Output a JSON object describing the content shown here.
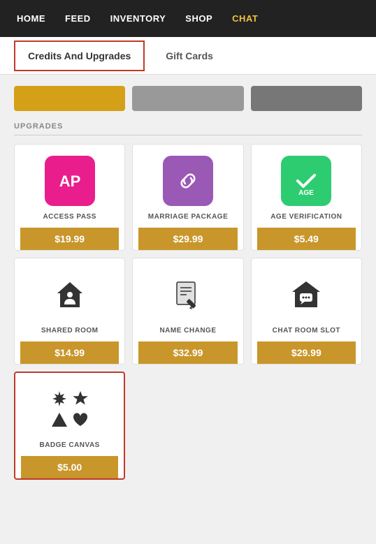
{
  "nav": {
    "items": [
      {
        "label": "HOME",
        "active": false
      },
      {
        "label": "FEED",
        "active": false
      },
      {
        "label": "INVENTORY",
        "active": false
      },
      {
        "label": "SHOP",
        "active": false
      },
      {
        "label": "CHAT",
        "active": true
      }
    ]
  },
  "tabs": {
    "items": [
      {
        "label": "Credits And Upgrades",
        "active": true
      },
      {
        "label": "Gift Cards",
        "active": false
      }
    ]
  },
  "section": {
    "label": "UPGRADES"
  },
  "upgrades": [
    {
      "id": "access-pass",
      "name": "ACCESS PASS",
      "price": "$19.99",
      "iconType": "ap",
      "highlighted": false
    },
    {
      "id": "marriage-package",
      "name": "MARRIAGE PACKAGE",
      "price": "$29.99",
      "iconType": "link",
      "highlighted": false
    },
    {
      "id": "age-verification",
      "name": "AGE VERIFICATION",
      "price": "$5.49",
      "iconType": "age",
      "highlighted": false
    },
    {
      "id": "shared-room",
      "name": "SHARED ROOM",
      "price": "$14.99",
      "iconType": "shared-room",
      "highlighted": false
    },
    {
      "id": "name-change",
      "name": "NAME CHANGE",
      "price": "$32.99",
      "iconType": "name-change",
      "highlighted": false
    },
    {
      "id": "chat-room-slot",
      "name": "CHAT ROOM SLOT",
      "price": "$29.99",
      "iconType": "chat-room",
      "highlighted": false
    },
    {
      "id": "badge-canvas",
      "name": "BADGE CANVAS",
      "price": "$5.00",
      "iconType": "badge-canvas",
      "highlighted": true
    }
  ]
}
